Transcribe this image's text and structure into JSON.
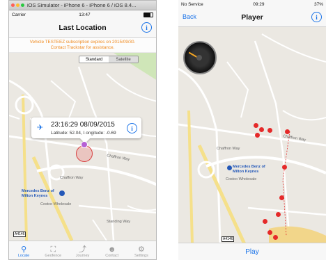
{
  "left": {
    "simulator_title": "iOS Simulator - iPhone 6 - iPhone 6 / iOS 8.4...",
    "carrier": "Carrier",
    "time": "13:47",
    "nav_title": "Last Location",
    "banner_line1": "Vehicle TESTEEZ subscription expires on 2015/09/30.",
    "banner_line2": "Contact Trackstar for assistance.",
    "map_types": [
      "Standard",
      "Satellite"
    ],
    "callout": {
      "timestamp": "23:16:29 08/09/2015",
      "lat_label": "Latitude: 52.04",
      "lon_label": "Longitude: -0.69"
    },
    "map_labels": {
      "road1": "Chaffron Way",
      "road2": "Chaffron Way",
      "poi_line1": "Mercedes Benz of",
      "poi_line2": "Milton Keynes",
      "store": "Costco Wholesale",
      "road_tag": "A4146",
      "street": "Standing Way"
    },
    "tabs": [
      {
        "label": "Locate",
        "icon": "location-pin-icon",
        "active": true
      },
      {
        "label": "Geofence",
        "icon": "geofence-icon",
        "active": false
      },
      {
        "label": "Journey",
        "icon": "journey-icon",
        "active": false
      },
      {
        "label": "Contact",
        "icon": "contact-icon",
        "active": false
      },
      {
        "label": "Settings",
        "icon": "settings-icon",
        "active": false
      }
    ]
  },
  "right": {
    "carrier": "No Service",
    "time": "09:29",
    "battery": "37%",
    "back_label": "Back",
    "nav_title": "Player",
    "map_labels": {
      "road1": "Chaffron Way",
      "road2": "Chaffron Way",
      "poi_line1": "Mercedes Benz of",
      "poi_line2": "Milton Keynes",
      "store": "Costco Wholesale",
      "road_tag": "A4146"
    },
    "play_label": "Play"
  },
  "colors": {
    "accent": "#1a73e8",
    "banner_text": "#f08a1e",
    "pin": "#e52a2a",
    "map_bg": "#ebe8e2",
    "road": "#ffffff",
    "major_road": "#f5e08a",
    "park": "#cfe6b8"
  }
}
